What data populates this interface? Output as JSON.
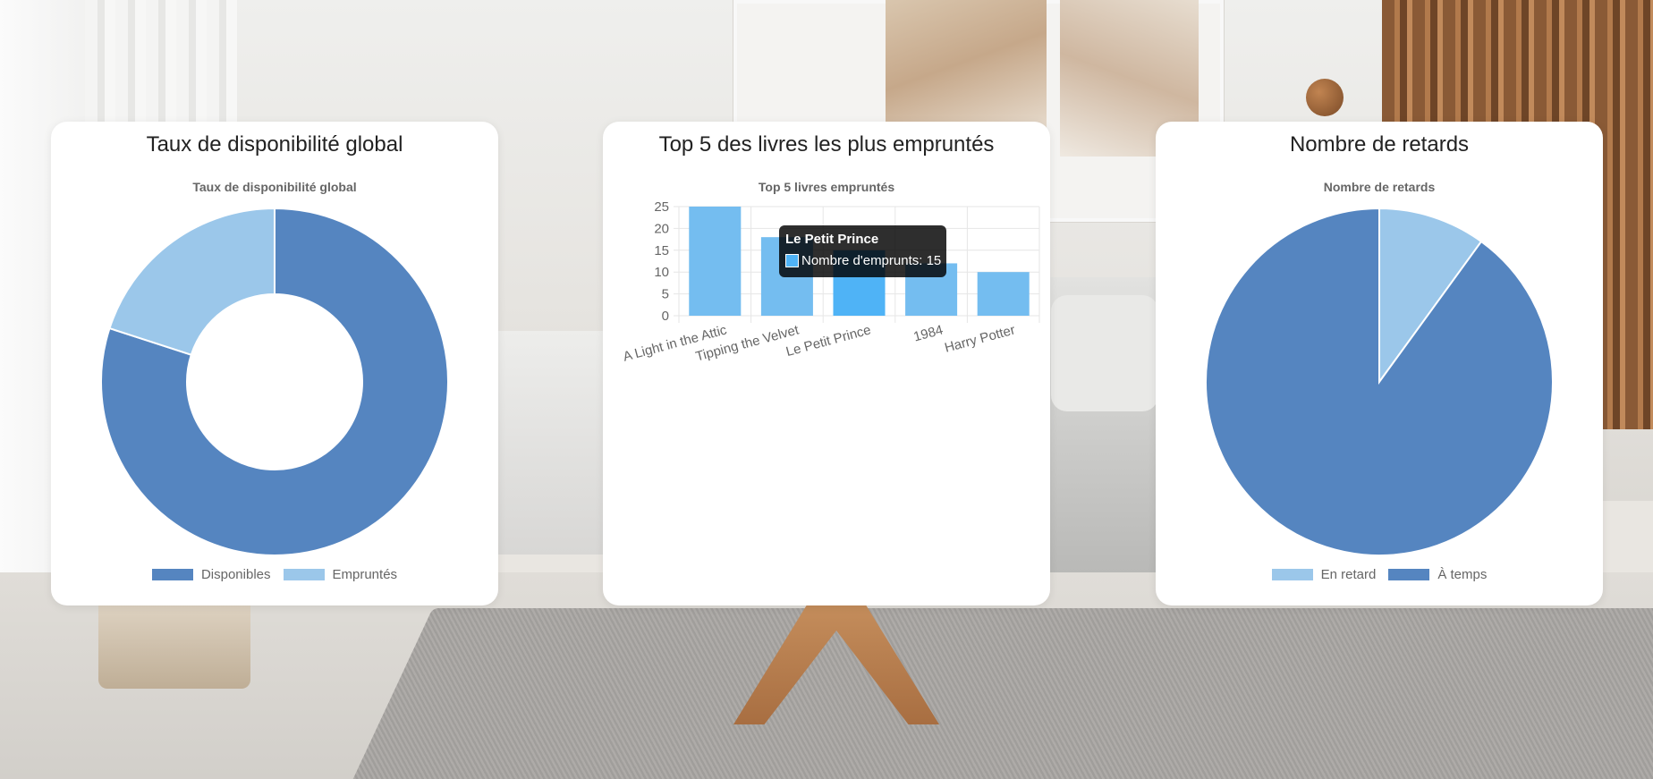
{
  "cards": [
    {
      "title": "Taux de disponibilité global",
      "chart_title": "Taux de disponibilité global",
      "legend": [
        {
          "label": "Disponibles",
          "color": "#5585c0"
        },
        {
          "label": "Empruntés",
          "color": "#9bc7ea"
        }
      ]
    },
    {
      "title": "Top 5 des livres les plus empruntés",
      "chart_title": "Top 5 livres empruntés",
      "tooltip": {
        "title": "Le Petit Prince",
        "label": "Nombre d'emprunts: 15"
      }
    },
    {
      "title": "Nombre de retards",
      "chart_title": "Nombre de retards",
      "legend": [
        {
          "label": "En retard",
          "color": "#9bc7ea"
        },
        {
          "label": "À temps",
          "color": "#5585c0"
        }
      ]
    }
  ],
  "chart_data": [
    {
      "type": "pie",
      "variant": "doughnut",
      "title": "Taux de disponibilité global",
      "labels": [
        "Disponibles",
        "Empruntés"
      ],
      "values": [
        80,
        20
      ],
      "colors": [
        "#5585c0",
        "#9bc7ea"
      ],
      "legend_position": "bottom"
    },
    {
      "type": "bar",
      "title": "Top 5 livres empruntés",
      "categories": [
        "A Light in the Attic",
        "Tipping the Velvet",
        "Le Petit Prince",
        "1984",
        "Harry Potter"
      ],
      "series": [
        {
          "name": "Nombre d'emprunts",
          "values": [
            25,
            18,
            15,
            12,
            10
          ]
        }
      ],
      "ylim": [
        0,
        25
      ],
      "yticks": [
        0,
        5,
        10,
        15,
        20,
        25
      ],
      "grid": true,
      "colors": {
        "bar": "#74bdf0",
        "bar_hover": "#4fb3f6"
      },
      "highlighted_category": "Le Petit Prince"
    },
    {
      "type": "pie",
      "title": "Nombre de retards",
      "labels": [
        "En retard",
        "À temps"
      ],
      "values": [
        10,
        90
      ],
      "colors": [
        "#9bc7ea",
        "#5585c0"
      ],
      "legend_position": "bottom"
    }
  ]
}
